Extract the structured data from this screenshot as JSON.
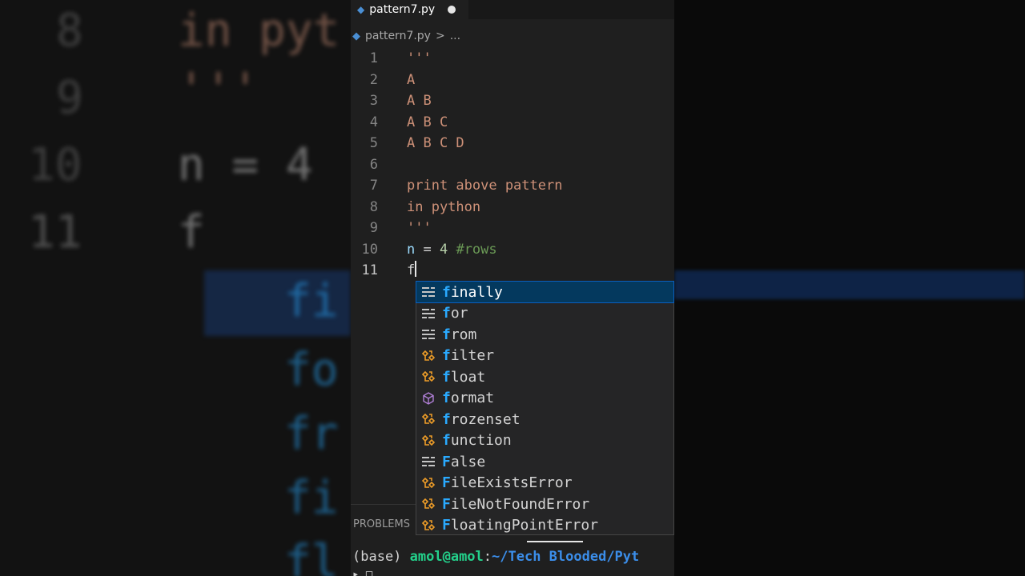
{
  "tab": {
    "file_name": "pattern7.py"
  },
  "breadcrumb": {
    "file_name": "pattern7.py",
    "separator": ">",
    "ellipsis": "..."
  },
  "lines": [
    {
      "num": "1",
      "text": "'''"
    },
    {
      "num": "2",
      "text": "A"
    },
    {
      "num": "3",
      "text": "A B"
    },
    {
      "num": "4",
      "text": "A B C"
    },
    {
      "num": "5",
      "text": "A B C D"
    },
    {
      "num": "6",
      "text": ""
    },
    {
      "num": "7",
      "text": "print above pattern"
    },
    {
      "num": "8",
      "text": "in python"
    },
    {
      "num": "9",
      "text": "'''"
    },
    {
      "num": "10",
      "var": "n",
      "op": " = ",
      "value": "4",
      "comment": " #rows"
    },
    {
      "num": "11",
      "text": "f"
    }
  ],
  "suggestions": [
    {
      "match": "f",
      "rest": "inally",
      "icon": "keyword-icon"
    },
    {
      "match": "f",
      "rest": "or",
      "icon": "keyword-icon"
    },
    {
      "match": "f",
      "rest": "rom",
      "icon": "keyword-icon"
    },
    {
      "match": "f",
      "rest": "ilter",
      "icon": "class-icon"
    },
    {
      "match": "f",
      "rest": "loat",
      "icon": "class-icon"
    },
    {
      "match": "f",
      "rest": "ormat",
      "icon": "method-icon"
    },
    {
      "match": "f",
      "rest": "rozenset",
      "icon": "class-icon"
    },
    {
      "match": "f",
      "rest": "unction",
      "icon": "class-icon"
    },
    {
      "match": "F",
      "rest": "alse",
      "icon": "keyword-icon"
    },
    {
      "match": "F",
      "rest": "ileExistsError",
      "icon": "class-icon"
    },
    {
      "match": "F",
      "rest": "ileNotFoundError",
      "icon": "class-icon"
    },
    {
      "match": "F",
      "rest": "loatingPointError",
      "icon": "class-icon"
    }
  ],
  "panel": {
    "title": "PROBLEMS"
  },
  "terminal": {
    "env": "(base) ",
    "user": "amol@amol",
    "colon": ":",
    "path": "~/Tech Blooded/Pyt",
    "next": "▸ □"
  },
  "background_zoom": {
    "line_numbers": [
      "8",
      "9",
      "10",
      "11"
    ],
    "lines": [
      "in pyt",
      "'''",
      "n = 4",
      "f"
    ],
    "suggest_partial": [
      "fi",
      "fo",
      "fr",
      "fi",
      "fl"
    ]
  },
  "colors": {
    "editor_bg": "#1f1f1f",
    "string": "#ce9178",
    "match_highlight": "#2aaaff",
    "selection": "#04395e",
    "keyword_icon": "#c5c5c5",
    "class_icon": "#ee9d28",
    "method_icon": "#b180d7"
  }
}
